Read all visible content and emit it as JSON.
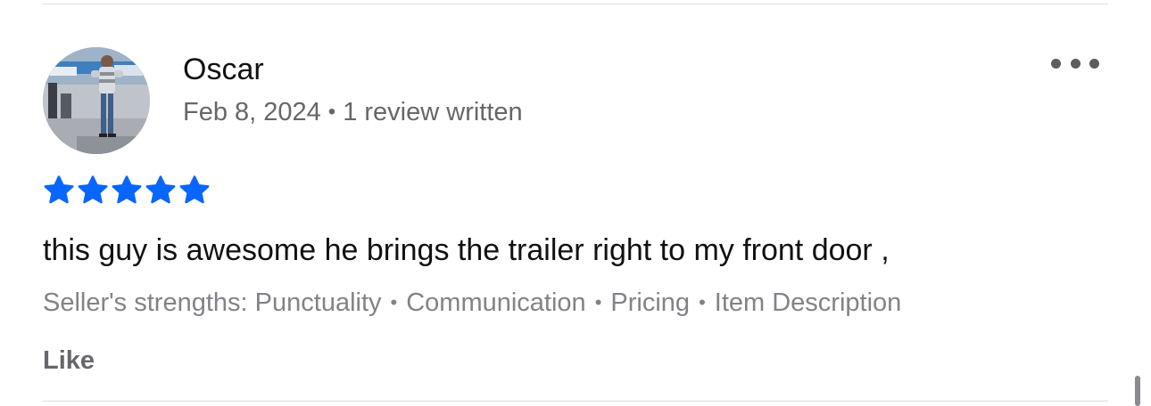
{
  "review": {
    "reviewer_name": "Oscar",
    "date": "Feb 8, 2024",
    "meta_separator": "•",
    "reviews_written": "1 review written",
    "rating": 5,
    "rating_max": 5,
    "star_color": "#0866ff",
    "text": "this guy is awesome he brings the trailer right to my front door ,",
    "strengths_label": "Seller's strengths:",
    "strengths": [
      "Punctuality",
      "Communication",
      "Pricing",
      "Item Description"
    ],
    "strengths_separator": "•",
    "like_label": "Like"
  },
  "icons": {
    "more": "more-options-icon",
    "star": "star-icon",
    "avatar": "avatar-photo"
  }
}
